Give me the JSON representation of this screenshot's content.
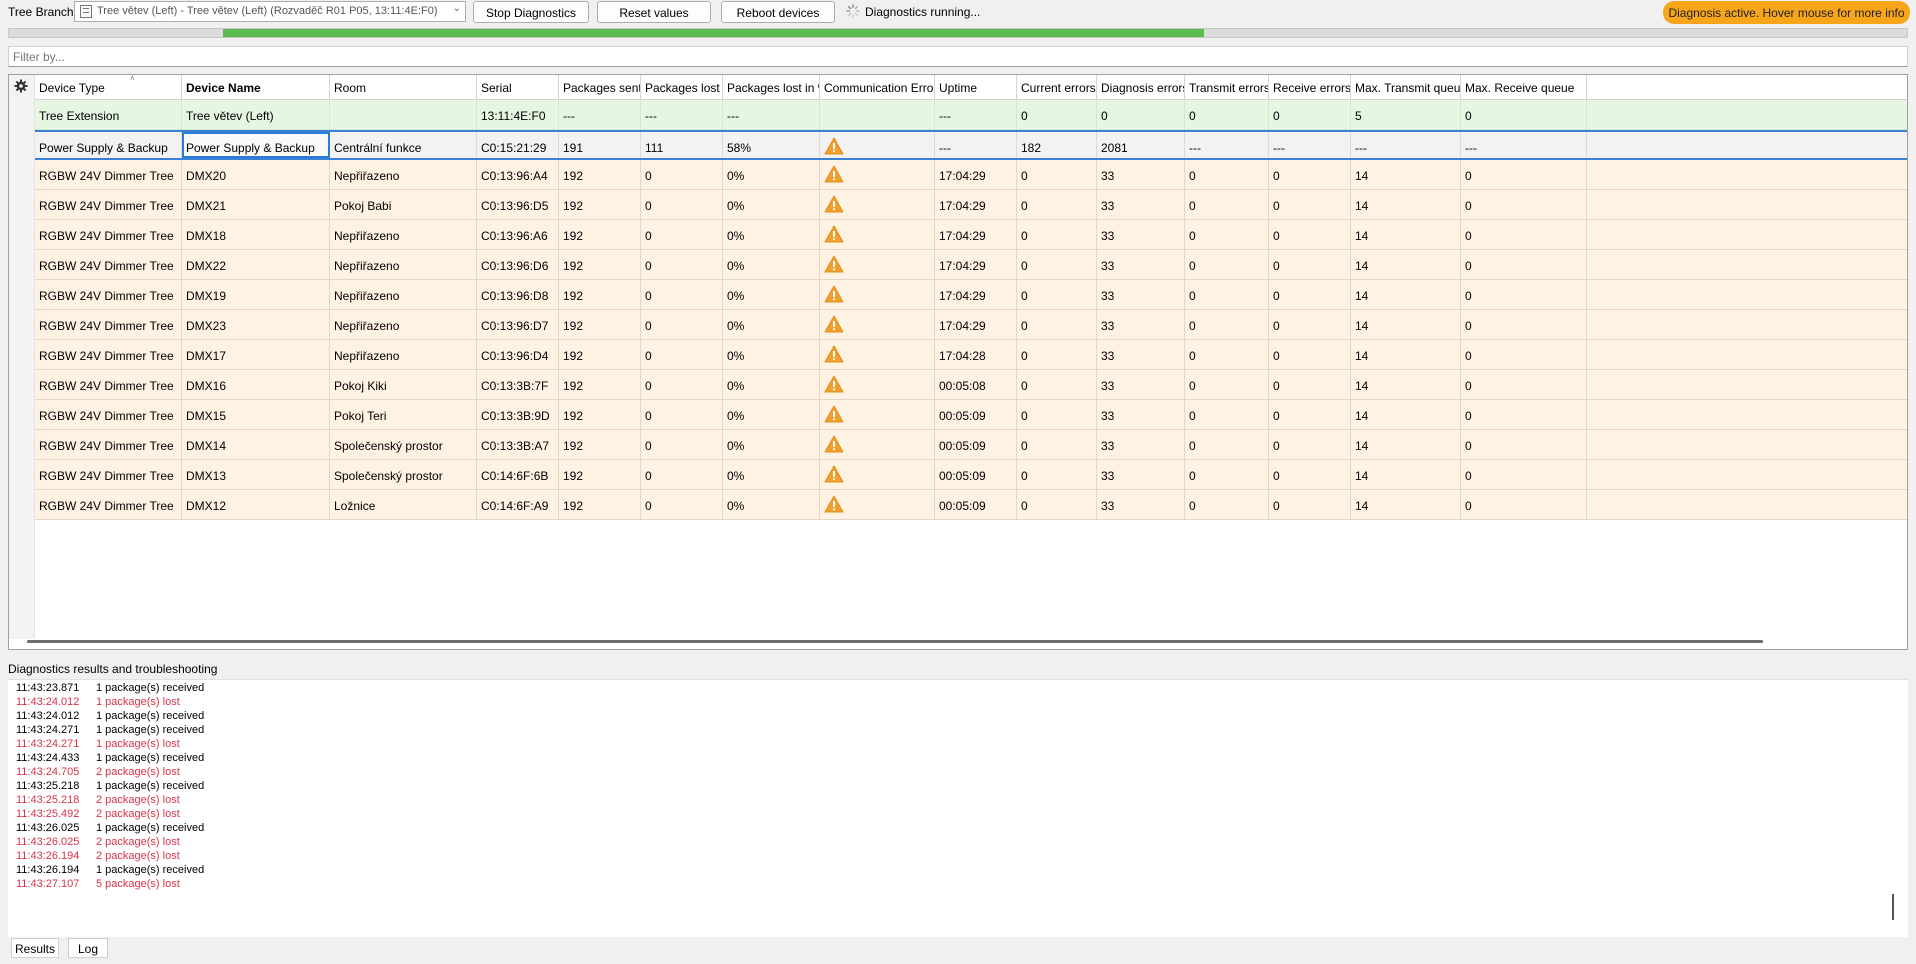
{
  "toolbar": {
    "label": "Tree Branch",
    "branch_value": "Tree větev (Left) - Tree větev (Left) (Rozvaděč R01 P05, 13:11:4E:F0)",
    "stop_label": "Stop Diagnostics",
    "reset_label": "Reset values",
    "reboot_label": "Reboot devices",
    "running_label": "Diagnostics running...",
    "badge_label": "Diagnosis active. Hover mouse for more info",
    "badge_color": "#f7a51a"
  },
  "progress": {
    "start_fraction": 0.113,
    "end_fraction": 0.63,
    "color": "#5cbb4f"
  },
  "filter": {
    "placeholder": "Filter by..."
  },
  "grid": {
    "columns": [
      "Device Type",
      "Device Name",
      "Room",
      "Serial",
      "Packages sent",
      "Packages lost",
      "Packages lost in %",
      "Communication Errors",
      "Uptime",
      "Current errors",
      "Diagnosis errors",
      "Transmit errors",
      "Receive errors",
      "Max. Transmit queue",
      "Max. Receive queue"
    ],
    "rows": [
      {
        "kind": "ext",
        "cells": [
          "Tree Extension",
          "Tree větev (Left)",
          "",
          "13:11:4E:F0",
          "---",
          "---",
          "---",
          "",
          "---",
          "0",
          "0",
          "0",
          "0",
          "5",
          "0"
        ],
        "warn": false
      },
      {
        "kind": "psu",
        "cells": [
          "Power Supply & Backup",
          "Power Supply & Backup",
          "Centrální funkce",
          "C0:15:21:29",
          "191",
          "111",
          "58%",
          "",
          "---",
          "182",
          "2081",
          "---",
          "---",
          "---",
          "---"
        ],
        "warn": true
      },
      {
        "kind": "dim",
        "cells": [
          "RGBW 24V Dimmer Tree",
          "DMX20",
          "Nepřiřazeno",
          "C0:13:96:A4",
          "192",
          "0",
          "0%",
          "",
          "17:04:29",
          "0",
          "33",
          "0",
          "0",
          "14",
          "0"
        ],
        "warn": true
      },
      {
        "kind": "dim",
        "cells": [
          "RGBW 24V Dimmer Tree",
          "DMX21",
          "Pokoj Babi",
          "C0:13:96:D5",
          "192",
          "0",
          "0%",
          "",
          "17:04:29",
          "0",
          "33",
          "0",
          "0",
          "14",
          "0"
        ],
        "warn": true
      },
      {
        "kind": "dim",
        "cells": [
          "RGBW 24V Dimmer Tree",
          "DMX18",
          "Nepřiřazeno",
          "C0:13:96:A6",
          "192",
          "0",
          "0%",
          "",
          "17:04:29",
          "0",
          "33",
          "0",
          "0",
          "14",
          "0"
        ],
        "warn": true
      },
      {
        "kind": "dim",
        "cells": [
          "RGBW 24V Dimmer Tree",
          "DMX22",
          "Nepřiřazeno",
          "C0:13:96:D6",
          "192",
          "0",
          "0%",
          "",
          "17:04:29",
          "0",
          "33",
          "0",
          "0",
          "14",
          "0"
        ],
        "warn": true
      },
      {
        "kind": "dim",
        "cells": [
          "RGBW 24V Dimmer Tree",
          "DMX19",
          "Nepřiřazeno",
          "C0:13:96:D8",
          "192",
          "0",
          "0%",
          "",
          "17:04:29",
          "0",
          "33",
          "0",
          "0",
          "14",
          "0"
        ],
        "warn": true
      },
      {
        "kind": "dim",
        "cells": [
          "RGBW 24V Dimmer Tree",
          "DMX23",
          "Nepřiřazeno",
          "C0:13:96:D7",
          "192",
          "0",
          "0%",
          "",
          "17:04:29",
          "0",
          "33",
          "0",
          "0",
          "14",
          "0"
        ],
        "warn": true
      },
      {
        "kind": "dim",
        "cells": [
          "RGBW 24V Dimmer Tree",
          "DMX17",
          "Nepřiřazeno",
          "C0:13:96:D4",
          "192",
          "0",
          "0%",
          "",
          "17:04:28",
          "0",
          "33",
          "0",
          "0",
          "14",
          "0"
        ],
        "warn": true
      },
      {
        "kind": "dim",
        "cells": [
          "RGBW 24V Dimmer Tree",
          "DMX16",
          "Pokoj Kiki",
          "C0:13:3B:7F",
          "192",
          "0",
          "0%",
          "",
          "00:05:08",
          "0",
          "33",
          "0",
          "0",
          "14",
          "0"
        ],
        "warn": true
      },
      {
        "kind": "dim",
        "cells": [
          "RGBW 24V Dimmer Tree",
          "DMX15",
          "Pokoj Teri",
          "C0:13:3B:9D",
          "192",
          "0",
          "0%",
          "",
          "00:05:09",
          "0",
          "33",
          "0",
          "0",
          "14",
          "0"
        ],
        "warn": true
      },
      {
        "kind": "dim",
        "cells": [
          "RGBW 24V Dimmer Tree",
          "DMX14",
          "Společenský prostor",
          "C0:13:3B:A7",
          "192",
          "0",
          "0%",
          "",
          "00:05:09",
          "0",
          "33",
          "0",
          "0",
          "14",
          "0"
        ],
        "warn": true
      },
      {
        "kind": "dim",
        "cells": [
          "RGBW 24V Dimmer Tree",
          "DMX13",
          "Společenský prostor",
          "C0:14:6F:6B",
          "192",
          "0",
          "0%",
          "",
          "00:05:09",
          "0",
          "33",
          "0",
          "0",
          "14",
          "0"
        ],
        "warn": true
      },
      {
        "kind": "dim",
        "cells": [
          "RGBW 24V Dimmer Tree",
          "DMX12",
          "Ložnice",
          "C0:14:6F:A9",
          "192",
          "0",
          "0%",
          "",
          "00:05:09",
          "0",
          "33",
          "0",
          "0",
          "14",
          "0"
        ],
        "warn": true
      }
    ]
  },
  "results": {
    "title": "Diagnostics results and troubleshooting",
    "log": [
      {
        "time": "11:43:23.871",
        "msg": "1 package(s) received",
        "lost": false
      },
      {
        "time": "11:43:24.012",
        "msg": "1 package(s) lost",
        "lost": true
      },
      {
        "time": "11:43:24.012",
        "msg": "1 package(s) received",
        "lost": false
      },
      {
        "time": "11:43:24.271",
        "msg": "1 package(s) received",
        "lost": false
      },
      {
        "time": "11:43:24.271",
        "msg": "1 package(s) lost",
        "lost": true
      },
      {
        "time": "11:43:24.433",
        "msg": "1 package(s) received",
        "lost": false
      },
      {
        "time": "11:43:24.705",
        "msg": "2 package(s) lost",
        "lost": true
      },
      {
        "time": "11:43:25.218",
        "msg": "1 package(s) received",
        "lost": false
      },
      {
        "time": "11:43:25.218",
        "msg": "2 package(s) lost",
        "lost": true
      },
      {
        "time": "11:43:25.492",
        "msg": "2 package(s) lost",
        "lost": true
      },
      {
        "time": "11:43:26.025",
        "msg": "1 package(s) received",
        "lost": false
      },
      {
        "time": "11:43:26.025",
        "msg": "2 package(s) lost",
        "lost": true
      },
      {
        "time": "11:43:26.194",
        "msg": "2 package(s) lost",
        "lost": true
      },
      {
        "time": "11:43:26.194",
        "msg": "1 package(s) received",
        "lost": false
      },
      {
        "time": "11:43:27.107",
        "msg": "5 package(s) lost",
        "lost": true
      }
    ],
    "lost_color": "#d9334a"
  },
  "tabs": [
    "Results",
    "Log"
  ],
  "icons": {
    "settings": "gear-icon",
    "warning": "warning-icon",
    "spinner": "spinner-icon",
    "dropdown": "chevron-down-icon"
  }
}
